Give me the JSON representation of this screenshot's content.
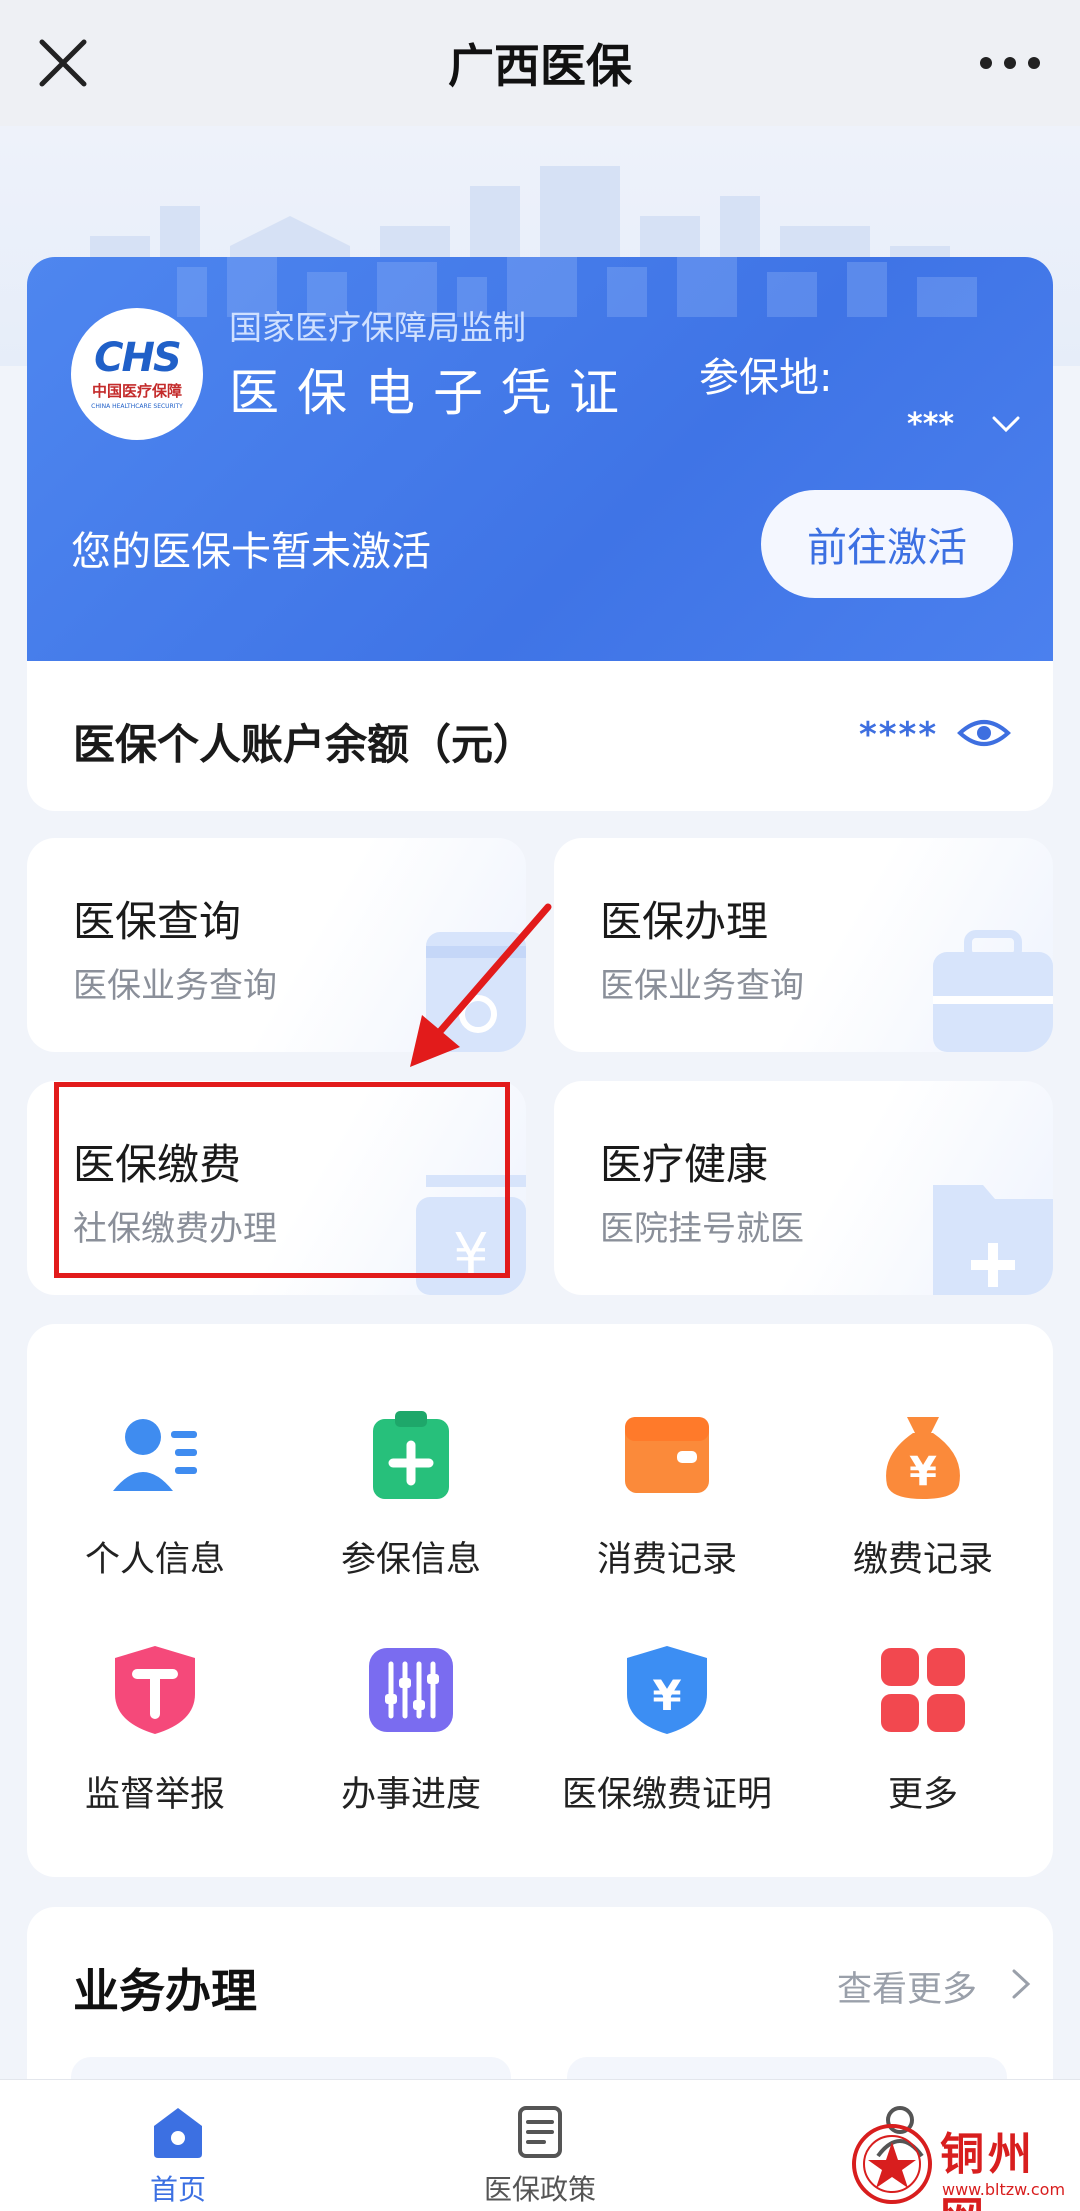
{
  "navbar": {
    "title": "广西医保"
  },
  "voucher": {
    "logo_mark": "CHS",
    "logo_cn": "中国医疗保障",
    "logo_en": "CHINA HEALTHCARE SECURITY",
    "supervise": "国家医疗保障局监制",
    "title": "医保电子凭证",
    "insured_label": "参保地:",
    "insured_value": "***",
    "inactive_text": "您的医保卡暂未激活",
    "activate_button": "前往激活",
    "accent_color": "#4278e8"
  },
  "balance": {
    "label": "医保个人账户余额（元）",
    "value": "****"
  },
  "quick_cards": [
    {
      "title": "医保查询",
      "subtitle": "医保业务查询"
    },
    {
      "title": "医保办理",
      "subtitle": "医保业务查询"
    },
    {
      "title": "医保缴费",
      "subtitle": "社保缴费办理"
    },
    {
      "title": "医疗健康",
      "subtitle": "医院挂号就医"
    }
  ],
  "services": [
    {
      "label": "个人信息",
      "icon": "person-info-icon"
    },
    {
      "label": "参保信息",
      "icon": "insurance-clipboard-icon"
    },
    {
      "label": "消费记录",
      "icon": "wallet-icon"
    },
    {
      "label": "缴费记录",
      "icon": "money-bag-icon"
    },
    {
      "label": "监督举报",
      "icon": "report-shield-icon"
    },
    {
      "label": "办事进度",
      "icon": "progress-sliders-icon"
    },
    {
      "label": "医保缴费证明",
      "icon": "payment-shield-icon"
    },
    {
      "label": "更多",
      "icon": "more-grid-icon"
    }
  ],
  "business": {
    "title": "业务办理",
    "more": "查看更多"
  },
  "tabbar": [
    {
      "label": "首页",
      "icon": "home-icon",
      "active": true
    },
    {
      "label": "医保政策",
      "icon": "policy-doc-icon",
      "active": false
    }
  ],
  "watermark": {
    "text": "铜州网",
    "url": "www.bltzw.com"
  }
}
